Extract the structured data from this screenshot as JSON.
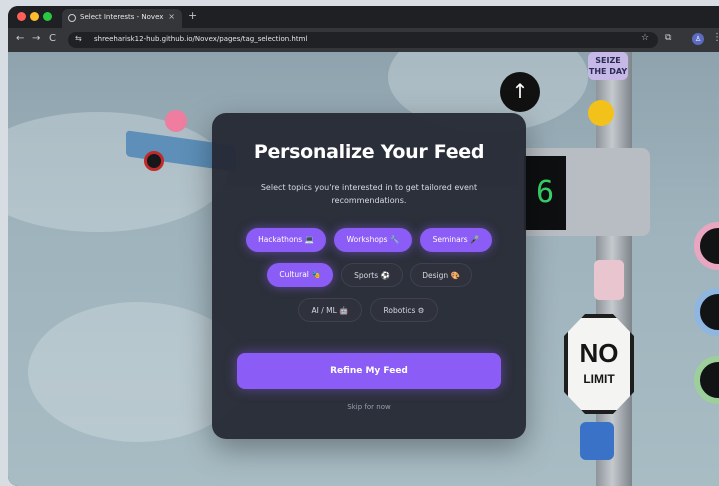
{
  "browser": {
    "tab_title": "Select Interests - Novex",
    "tab_close": "×",
    "new_tab": "+",
    "nav_back": "←",
    "nav_forward": "→",
    "nav_reload": "C",
    "site_info_icon": "⇆",
    "url": "shreeharisk12-hub.github.io/Novex/pages/tag_selection.html",
    "star_icon": "☆",
    "extensions_icon": "⧉",
    "profile_icon": "♙",
    "menu_icon": "⋮"
  },
  "background": {
    "arrow": "↑",
    "sign_top": "SEIZE THE DAY",
    "counter_digit": "6",
    "sign_no": "NO",
    "sign_limit": "LIMIT"
  },
  "modal": {
    "title": "Personalize Your Feed",
    "subtitle": "Select topics you're interested in to get tailored event recommendations.",
    "chips": [
      {
        "label": "Hackathons 💻",
        "selected": true
      },
      {
        "label": "Workshops 🔧",
        "selected": true
      },
      {
        "label": "Seminars 🎤",
        "selected": true
      },
      {
        "label": "Cultural 🎭",
        "selected": true
      },
      {
        "label": "Sports ⚽",
        "selected": false
      },
      {
        "label": "Design 🎨",
        "selected": false
      },
      {
        "label": "AI / ML 🤖",
        "selected": false
      },
      {
        "label": "Robotics ⚙",
        "selected": false
      }
    ],
    "cta_label": "Refine My Feed",
    "skip_label": "Skip for now"
  },
  "colors": {
    "accent": "#8c5cf6",
    "modal_bg": "#242732",
    "chip_unselected_bg": "#2f323d"
  }
}
